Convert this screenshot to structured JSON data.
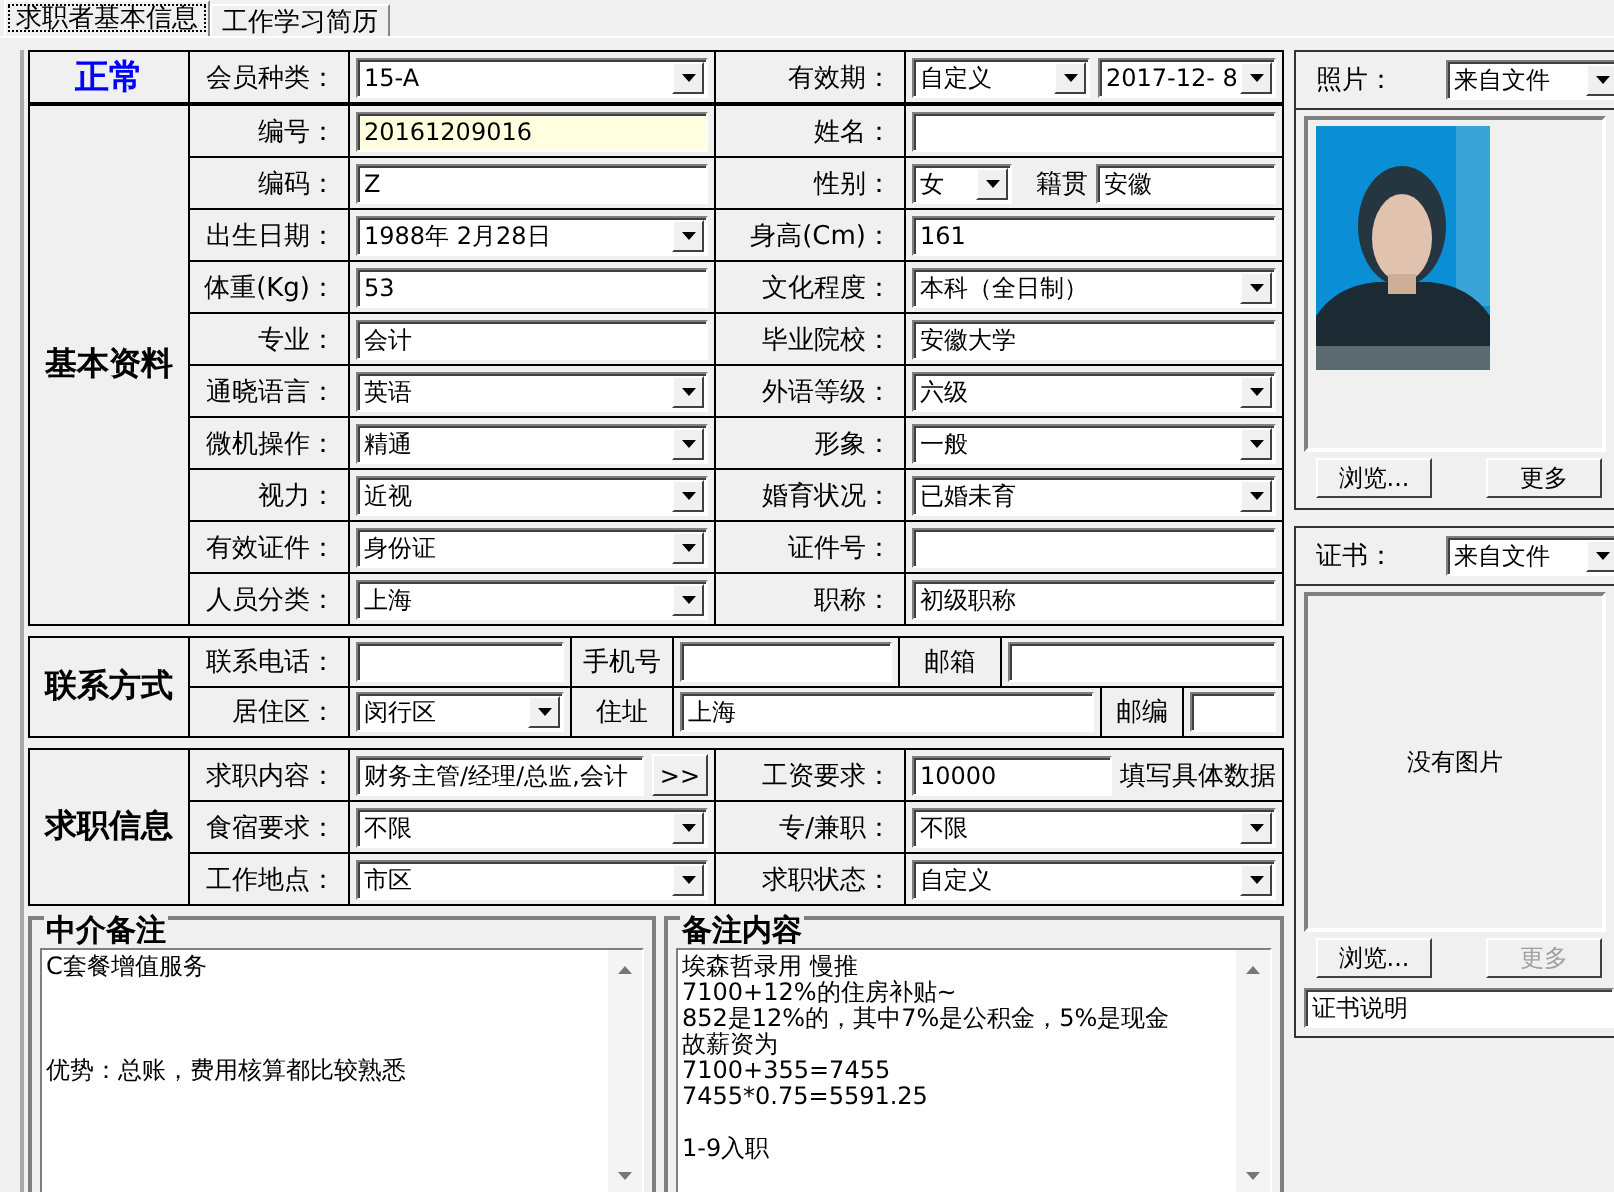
{
  "tabs": [
    {
      "label": "求职者基本信息",
      "selected": true
    },
    {
      "label": "工作学习简历",
      "selected": false
    }
  ],
  "status": "正常",
  "top_row": [
    {
      "label": "会员种类："
    },
    {
      "kind": "select",
      "value": "15-A"
    },
    {
      "label": "有效期："
    },
    {
      "fields": [
        {
          "kind": "select",
          "value": "自定义"
        },
        {
          "kind": "select",
          "value": "2017-12- 8"
        }
      ]
    }
  ],
  "basic": {
    "title": "基本资料",
    "rows": [
      [
        {
          "label": "编号："
        },
        {
          "kind": "focused_input",
          "value": "20161209016"
        },
        {
          "label": "姓名："
        },
        {
          "kind": "input"
        }
      ],
      [
        {
          "label": "编码："
        },
        {
          "kind": "input",
          "value": "Z"
        },
        {
          "label": "性别："
        },
        {
          "kind": "select",
          "value": "女",
          "extra_label": "籍贯",
          "extra_value": "安徽"
        }
      ],
      [
        {
          "label": "出生日期："
        },
        {
          "kind": "select",
          "value": "1988年 2月28日"
        },
        {
          "label": "身高(Cm)："
        },
        {
          "kind": "input",
          "value": "161"
        }
      ],
      [
        {
          "label": "体重(Kg)："
        },
        {
          "kind": "input",
          "value": "53"
        },
        {
          "label": "文化程度："
        },
        {
          "kind": "select",
          "value": "本科（全日制）"
        }
      ],
      [
        {
          "label": "专业："
        },
        {
          "kind": "input",
          "value": "会计"
        },
        {
          "label": "毕业院校："
        },
        {
          "kind": "input",
          "value": "安徽大学"
        }
      ],
      [
        {
          "label": "通晓语言："
        },
        {
          "kind": "select",
          "value": "英语"
        },
        {
          "label": "外语等级："
        },
        {
          "kind": "select",
          "value": "六级"
        }
      ],
      [
        {
          "label": "微机操作："
        },
        {
          "kind": "select",
          "value": "精通"
        },
        {
          "label": "形象："
        },
        {
          "kind": "select",
          "value": "一般"
        }
      ],
      [
        {
          "label": "视力："
        },
        {
          "kind": "select",
          "value": "近视"
        },
        {
          "label": "婚育状况："
        },
        {
          "kind": "select",
          "value": "已婚未育"
        }
      ],
      [
        {
          "label": "有效证件："
        },
        {
          "kind": "select",
          "value": "身份证"
        },
        {
          "label": "证件号："
        },
        {
          "kind": "input"
        }
      ],
      [
        {
          "label": "人员分类："
        },
        {
          "kind": "select",
          "value": "上海"
        },
        {
          "label": "职称："
        },
        {
          "kind": "input",
          "value": "初级职称"
        }
      ]
    ]
  },
  "contact": {
    "title": "联系方式",
    "rows": [
      [
        {
          "label": "联系电话："
        },
        {
          "kind": "input"
        },
        {
          "label": "手机号"
        },
        {
          "kind": "input"
        },
        {
          "label": "邮箱"
        },
        {
          "kind": "input"
        }
      ],
      [
        {
          "label": "居住区："
        },
        {
          "kind": "select",
          "value": "闵行区"
        },
        {
          "label": "住址"
        },
        {
          "kind": "input",
          "value": "上海"
        },
        {
          "label": "邮编"
        },
        {
          "kind": "input"
        }
      ]
    ]
  },
  "job": {
    "title": "求职信息",
    "rows": [
      [
        {
          "label": "求职内容："
        },
        {
          "kind": "picker",
          "value": "财务主管/经理/总监,会计",
          "button": ">>"
        },
        {
          "label": "工资要求："
        },
        {
          "kind": "input",
          "value": "10000",
          "hint": "填写具体数据"
        }
      ],
      [
        {
          "label": "食宿要求："
        },
        {
          "kind": "select",
          "value": "不限"
        },
        {
          "label": "专/兼职："
        },
        {
          "kind": "select",
          "value": "不限"
        }
      ],
      [
        {
          "label": "工作地点："
        },
        {
          "kind": "select",
          "value": "市区"
        },
        {
          "label": "求职状态："
        },
        {
          "kind": "select",
          "value": "自定义"
        }
      ]
    ]
  },
  "remarks": [
    {
      "title": "中介备注",
      "paragraphs": [
        [
          "C套餐增值服务"
        ],
        [
          "优势：总账，费用核算都比较熟悉"
        ]
      ]
    },
    {
      "title": "备注内容",
      "paragraphs": [
        [
          "埃森哲录用 慢推",
          "7100+12%的住房补贴~",
          "852是12%的，其中7%是公积金，5%是现金",
          "故薪资为",
          "7100+355=7455",
          "7455*0.75=5591.25"
        ],
        [
          "1-9入职"
        ]
      ]
    }
  ],
  "photo": {
    "label": "照片：",
    "source": "来自文件",
    "buttons": [
      {
        "label": "浏览...",
        "disabled": false
      },
      {
        "label": "更多",
        "disabled": false
      }
    ]
  },
  "certificate": {
    "label": "证书：",
    "source": "来自文件",
    "empty_text": "没有图片",
    "buttons": [
      {
        "label": "浏览...",
        "disabled": false
      },
      {
        "label": "更多",
        "disabled": true
      }
    ],
    "caption": "证书说明"
  }
}
